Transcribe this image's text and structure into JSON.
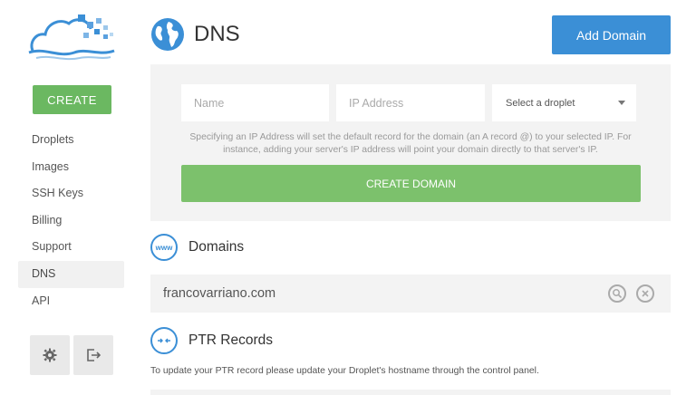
{
  "sidebar": {
    "create_label": "CREATE",
    "items": [
      {
        "label": "Droplets"
      },
      {
        "label": "Images"
      },
      {
        "label": "SSH Keys"
      },
      {
        "label": "Billing"
      },
      {
        "label": "Support"
      },
      {
        "label": "DNS"
      },
      {
        "label": "API"
      }
    ],
    "active": "DNS",
    "settings_icon": "gear-icon",
    "logout_icon": "logout-icon"
  },
  "header": {
    "title": "DNS",
    "add_domain_label": "Add Domain"
  },
  "form": {
    "name_placeholder": "Name",
    "ip_placeholder": "IP Address",
    "droplet_select": "Select a droplet",
    "help_text": "Specifying an IP Address will set the default record for the domain (an A record @) to your selected IP. For instance, adding your server's IP address will point your domain directly to that server's IP.",
    "create_domain_label": "CREATE DOMAIN"
  },
  "domains": {
    "title": "Domains",
    "icon_text": "www",
    "rows": [
      {
        "name": "francovarriano.com"
      }
    ]
  },
  "ptr": {
    "title": "PTR Records",
    "description": "To update your PTR record please update your Droplet's hostname through the control panel."
  },
  "colors": {
    "accent_blue": "#3b8fd6",
    "create_green": "#6bb861",
    "panel_gray": "#f3f3f3"
  }
}
